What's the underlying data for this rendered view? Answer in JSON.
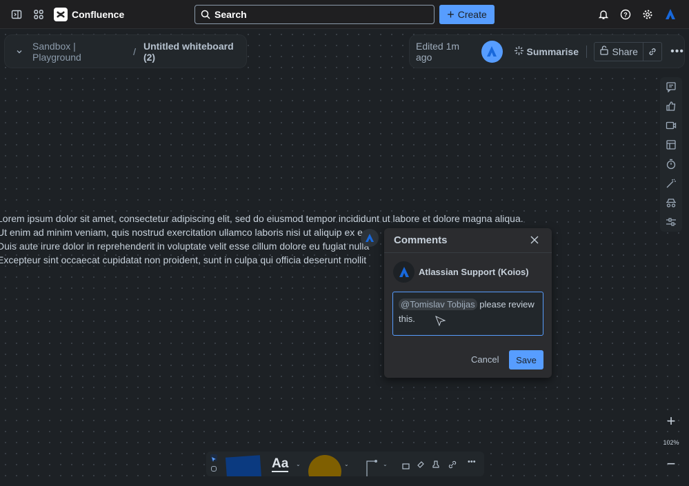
{
  "topbar": {
    "app_name": "Confluence",
    "search_placeholder": "Search",
    "create_label": "Create"
  },
  "breadcrumb": {
    "space": "Sandbox | Playground",
    "separator": "/",
    "page": "Untitled whiteboard (2)"
  },
  "header_actions": {
    "edited": "Edited 1m ago",
    "summarise": "Summarise",
    "share": "Share"
  },
  "canvas_text": [
    "Lorem ipsum dolor sit amet, consectetur adipiscing elit, sed do eiusmod tempor incididunt ut labore et dolore magna aliqua.",
    "Ut enim ad minim veniam, quis nostrud exercitation ullamco laboris nisi ut aliquip ex ea c",
    "Duis aute irure dolor in reprehenderit in voluptate velit esse cillum dolore eu fugiat nulla",
    "Excepteur sint occaecat cupidatat non proident, sunt in culpa qui officia deserunt mollit"
  ],
  "comments": {
    "title": "Comments",
    "author": "Atlassian Support (Koios)",
    "mention": "@Tomislav Tobijas",
    "text": "please review this.",
    "cancel": "Cancel",
    "save": "Save"
  },
  "zoom": {
    "level": "102%"
  },
  "toolbar": {
    "text_style": "Aa"
  },
  "colors": {
    "accent": "#579dff",
    "sticky": "#0b3a80",
    "shape": "#7f5f01"
  }
}
